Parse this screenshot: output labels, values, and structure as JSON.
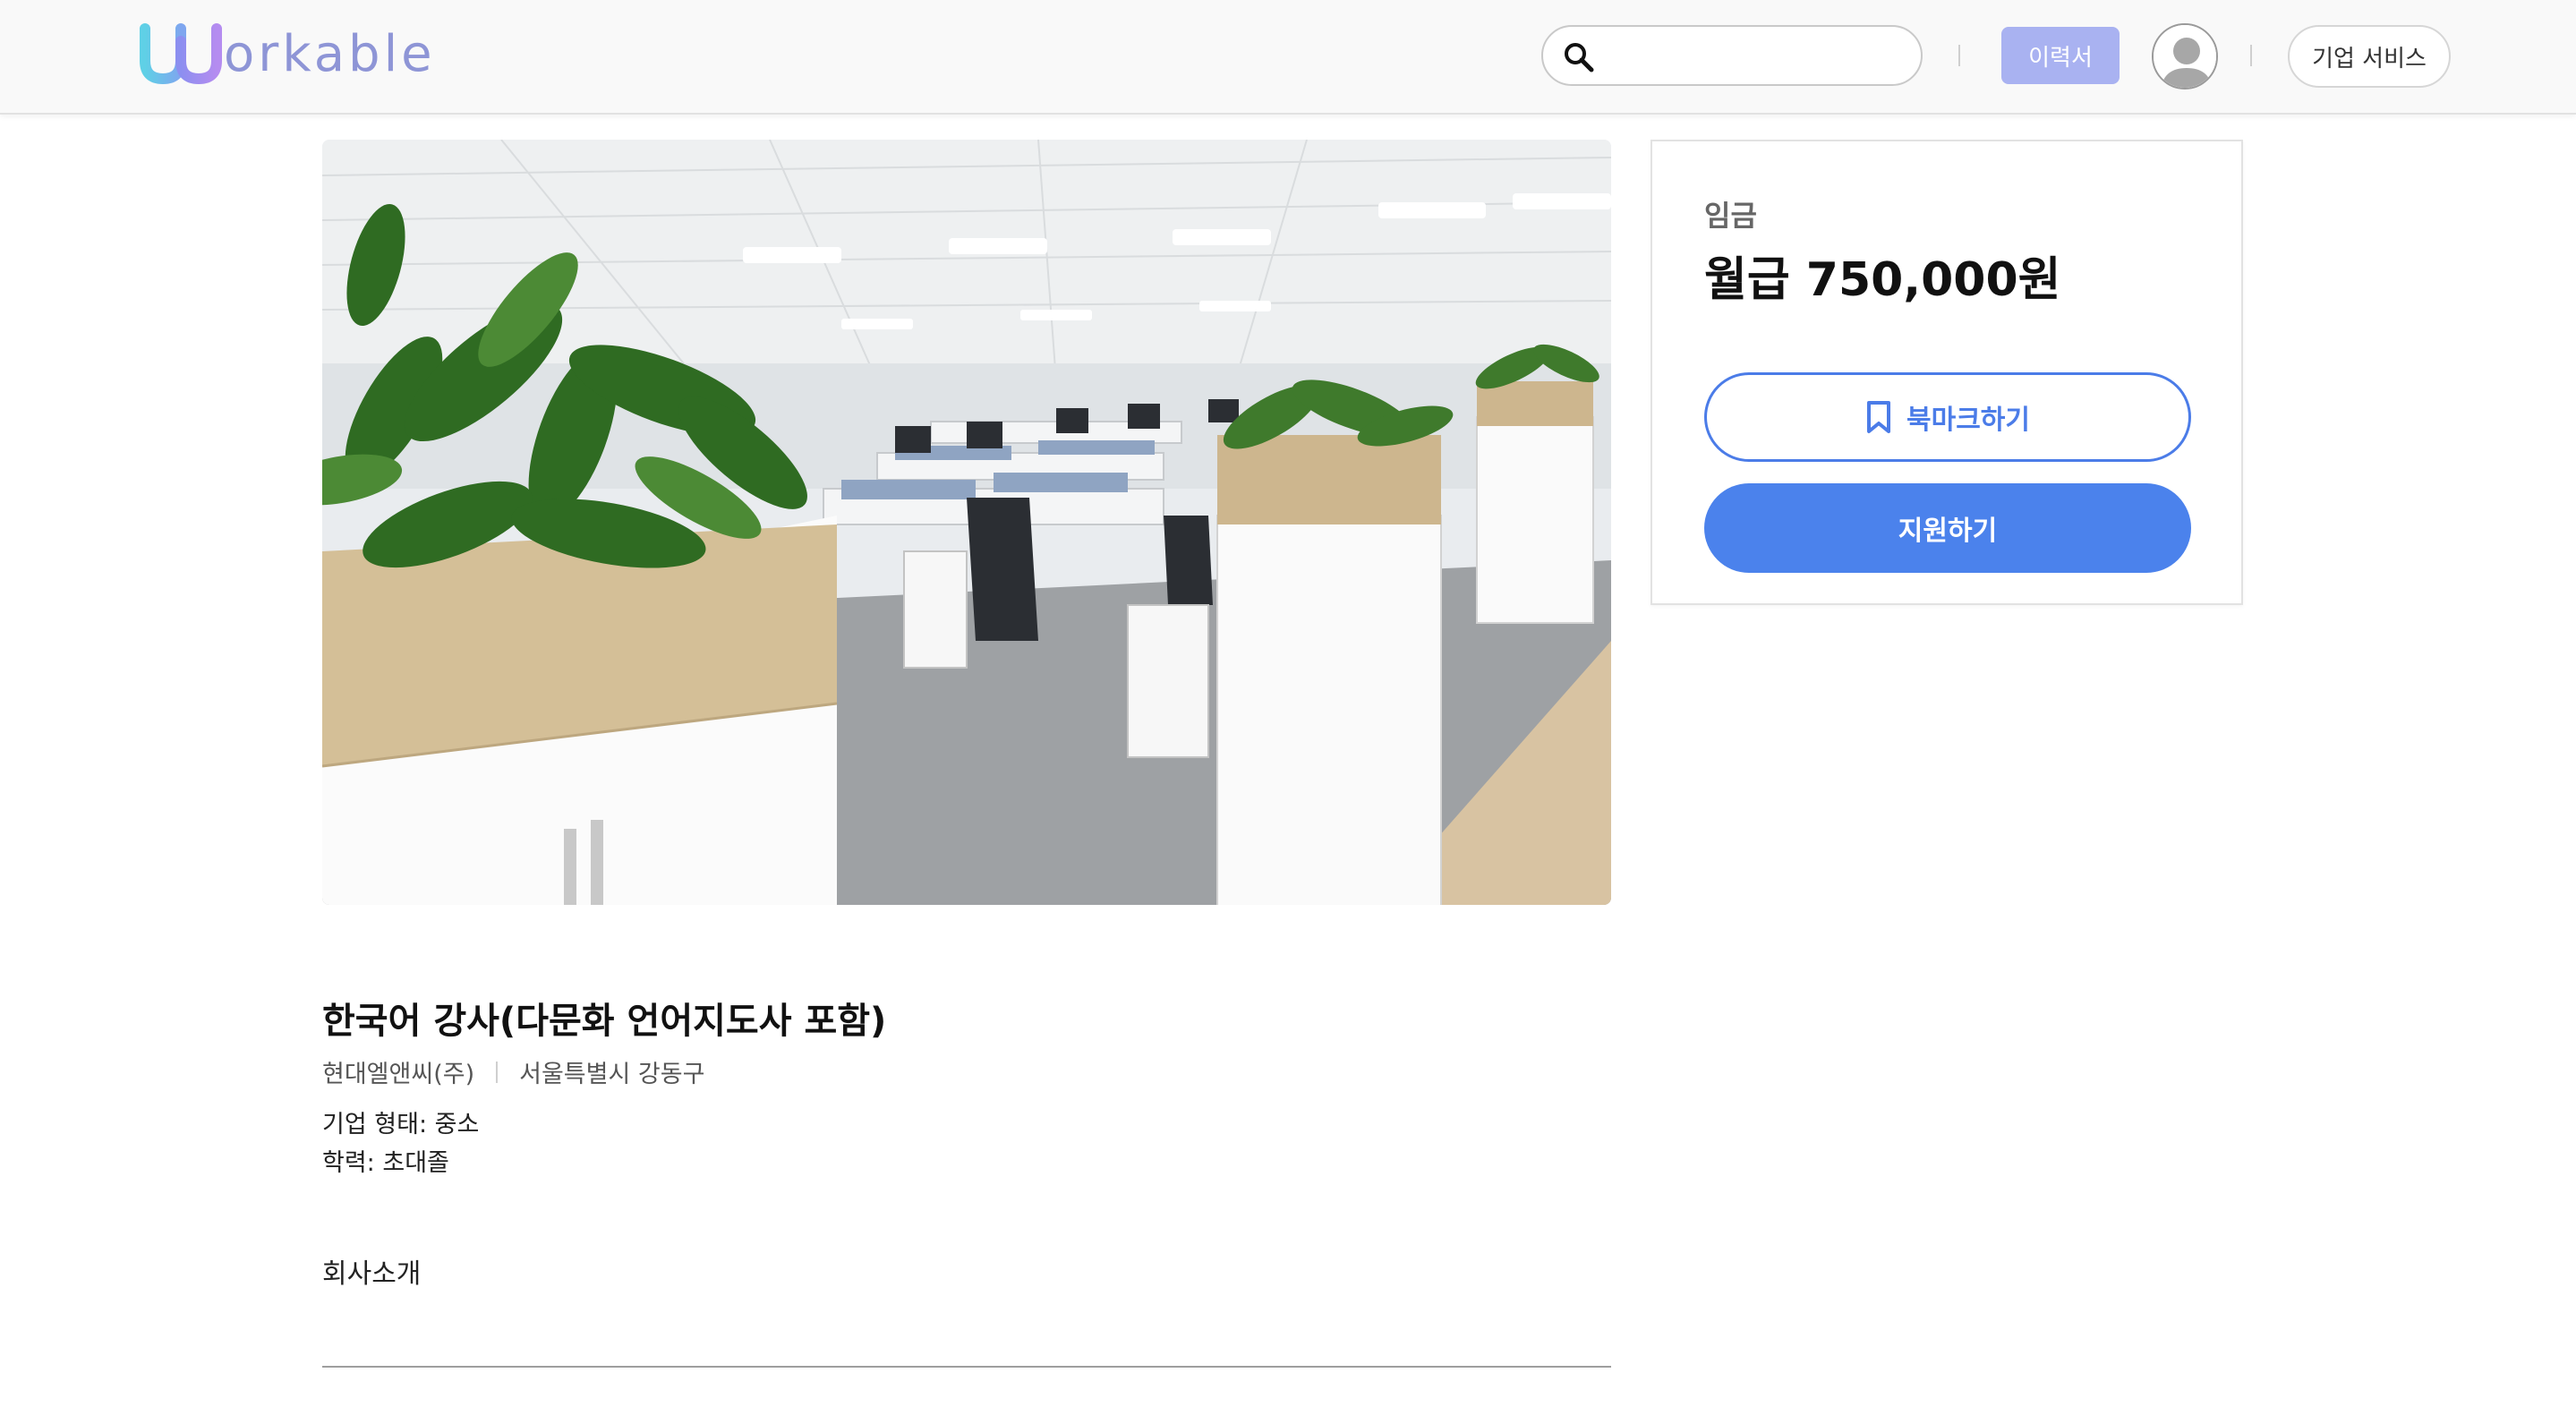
{
  "header": {
    "logo_text": "orkable",
    "search_placeholder": "",
    "resume_label": "이력서",
    "corporate_label": "기업 서비스"
  },
  "job": {
    "title": "한국어 강사(다문화 언어지도사 포함)",
    "company": "현대엘앤씨(주)",
    "location": "서울특별시 강동구",
    "company_type": "기업 형태: 중소",
    "education": "학력: 초대졸",
    "section_company_intro": "회사소개"
  },
  "panel": {
    "wage_label": "임금",
    "wage_value": "월급 750,000원",
    "bookmark_label": "북마크하기",
    "apply_label": "지원하기"
  },
  "colors": {
    "accent": "#4b82ec",
    "resume_button": "#a9b2f1",
    "logo": "#8e95d6"
  },
  "icons": [
    "search-icon",
    "bookmark-icon",
    "avatar-icon"
  ]
}
